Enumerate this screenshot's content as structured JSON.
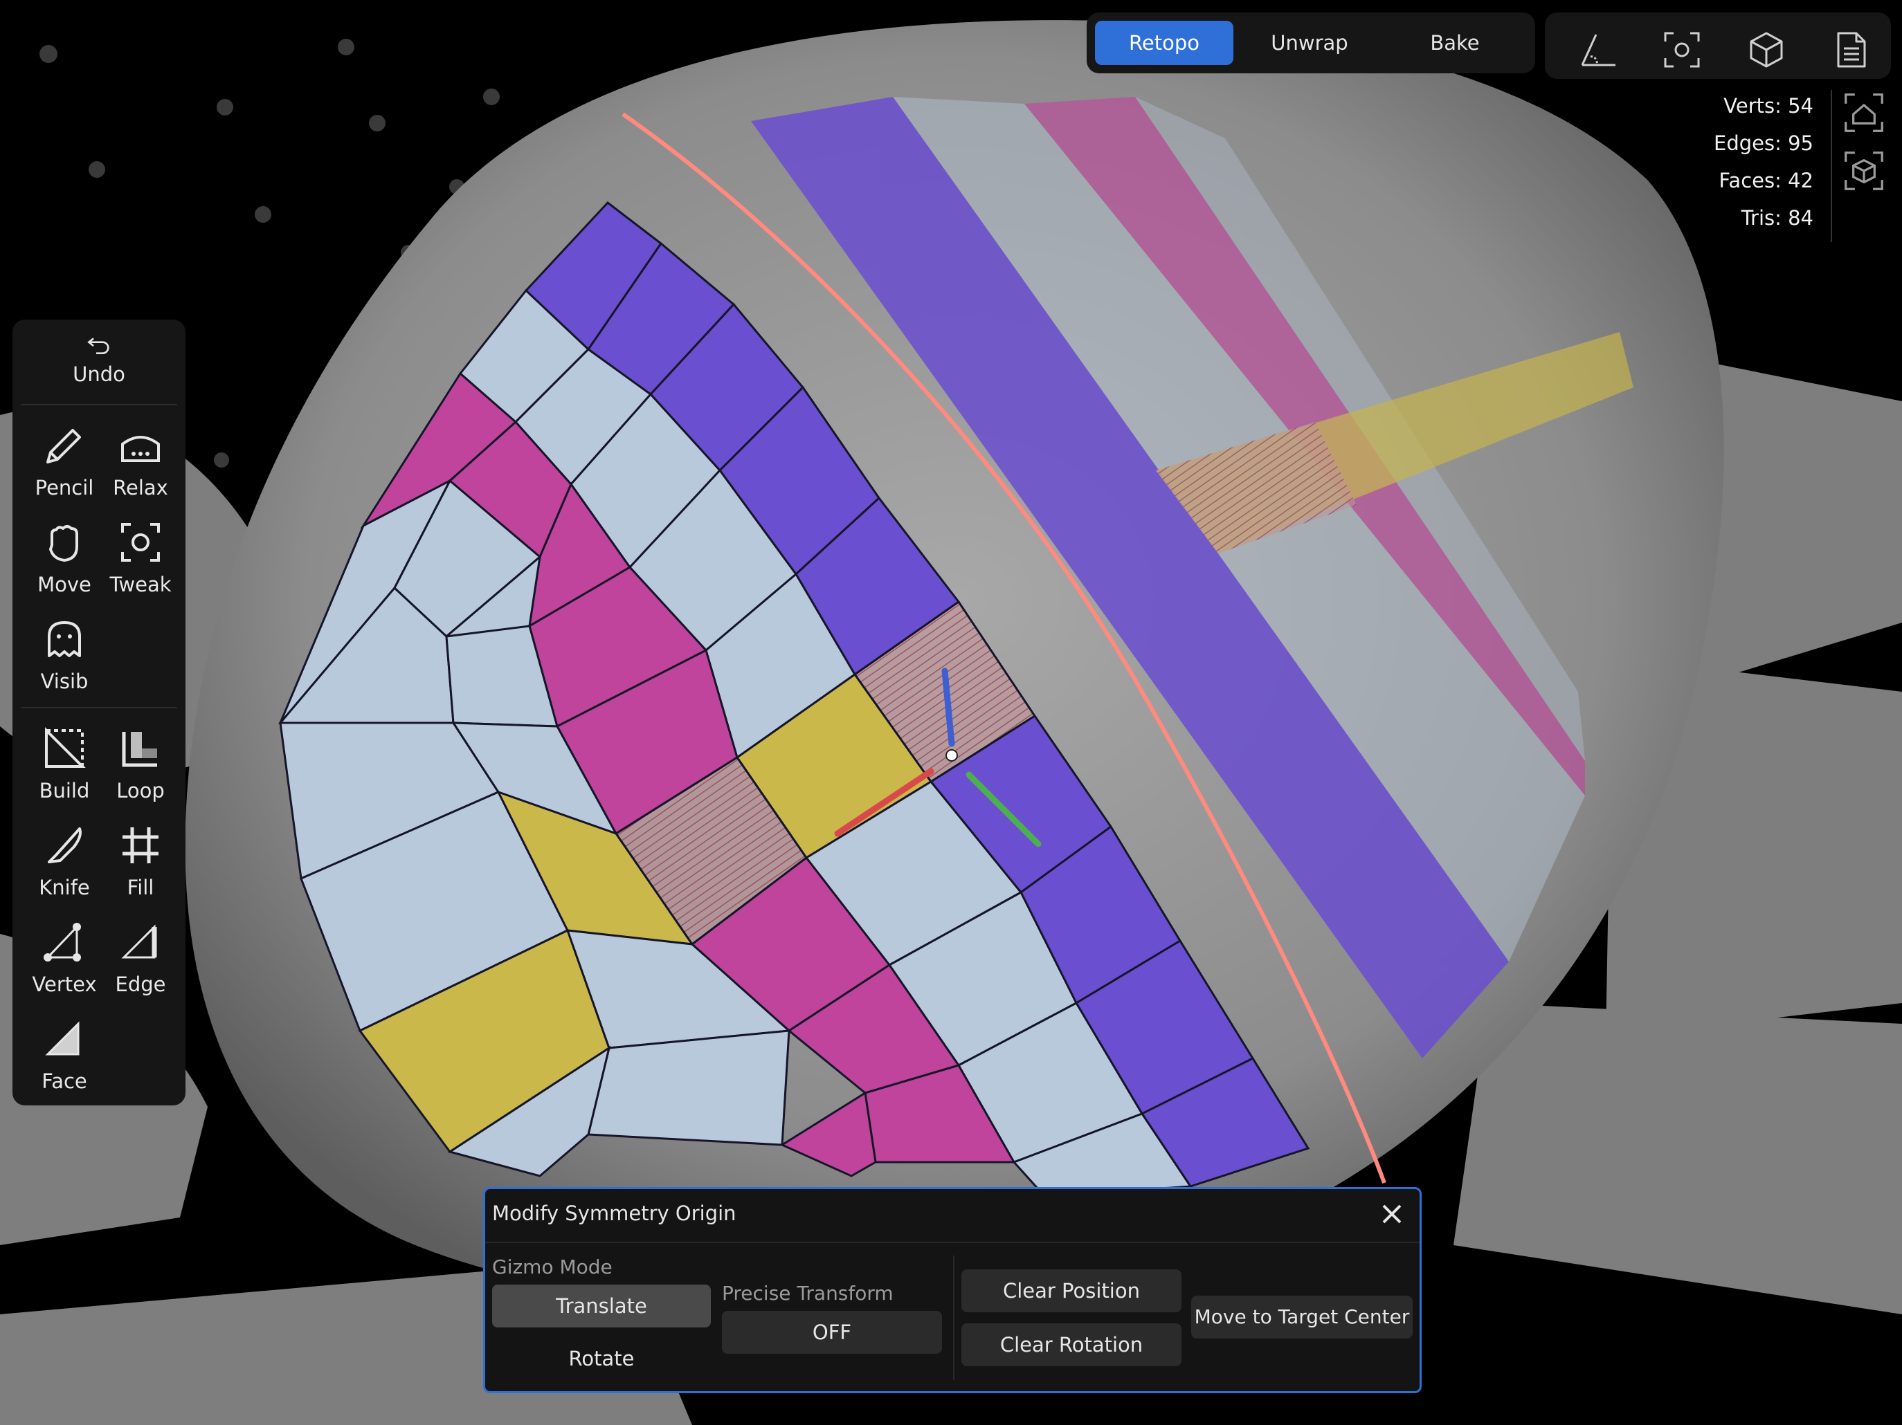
{
  "mode_tabs": [
    {
      "label": "Retopo",
      "active": true
    },
    {
      "label": "Unwrap",
      "active": false
    },
    {
      "label": "Bake",
      "active": false
    }
  ],
  "top_icons": [
    "measure-icon",
    "focus-icon",
    "cube-icon",
    "document-icon"
  ],
  "stats": {
    "verts_label": "Verts:",
    "verts": "54",
    "edges_label": "Edges:",
    "edges": "95",
    "faces_label": "Faces:",
    "faces": "42",
    "tris_label": "Tris:",
    "tris": "84"
  },
  "toolbar": {
    "undo": "Undo",
    "pencil": "Pencil",
    "relax": "Relax",
    "move": "Move",
    "tweak": "Tweak",
    "visib": "Visib",
    "build": "Build",
    "loop": "Loop",
    "knife": "Knife",
    "fill": "Fill",
    "vertex": "Vertex",
    "edge": "Edge",
    "face": "Face"
  },
  "dialog": {
    "title": "Modify Symmetry Origin",
    "gizmo_mode_label": "Gizmo Mode",
    "translate": "Translate",
    "rotate": "Rotate",
    "precise_label": "Precise Transform",
    "precise_value": "OFF",
    "clear_position": "Clear Position",
    "clear_rotation": "Clear Rotation",
    "move_to_center": "Move to Target Center"
  },
  "colors": {
    "accent": "#2f6fd8",
    "quad_blue": "#b9c9dc",
    "quad_purple": "#6a4fd0",
    "quad_pink": "#c0449c",
    "quad_yellow": "#cbb84a",
    "symmetry_line": "#ff8a80"
  }
}
